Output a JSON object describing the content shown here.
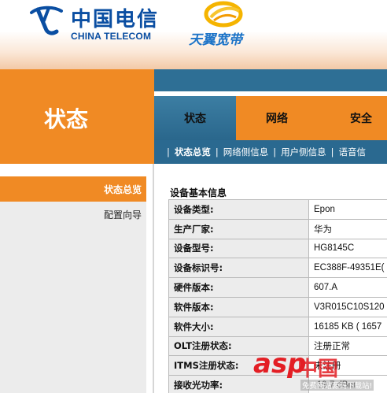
{
  "brand": {
    "telecom_cn": "中国电信",
    "telecom_en": "CHINA TELECOM",
    "broadband_cn": "天翼宽带",
    "telecom_color": "#0a4ea2",
    "accent_orange": "#f08a24",
    "nav_blue": "#2a6990"
  },
  "page_title": "状态",
  "tabs": [
    {
      "label": "状态",
      "active": true
    },
    {
      "label": "网络",
      "active": false
    },
    {
      "label": "安全",
      "active": false
    }
  ],
  "subnav": [
    {
      "label": "状态总览",
      "active": true
    },
    {
      "label": "网络侧信息",
      "active": false
    },
    {
      "label": "用户侧信息",
      "active": false
    },
    {
      "label": "语音信",
      "active": false
    }
  ],
  "sidebar": {
    "items": [
      {
        "label": "状态总览",
        "active": true
      },
      {
        "label": "配置向导",
        "active": false
      }
    ]
  },
  "device_info": {
    "title": "设备基本信息",
    "rows": [
      {
        "key": "设备类型:",
        "value": "Epon"
      },
      {
        "key": "生产厂家:",
        "value": "华为"
      },
      {
        "key": "设备型号:",
        "value": "HG8145C"
      },
      {
        "key": "设备标识号:",
        "value": "EC388F-49351E("
      },
      {
        "key": "硬件版本:",
        "value": "607.A"
      },
      {
        "key": "软件版本:",
        "value": "V3R015C10S120"
      },
      {
        "key": "软件大小:",
        "value": "16185 KB ( 1657"
      },
      {
        "key": "OLT注册状态:",
        "value": "注册正常"
      },
      {
        "key": "ITMS注册状态:",
        "value": "未注册"
      },
      {
        "key": "接收光功率:",
        "value": "-19.7 dBm"
      }
    ]
  },
  "watermark": {
    "asp": "asp",
    "cn": "中国",
    "sub": "免费网站源码下载站!"
  }
}
